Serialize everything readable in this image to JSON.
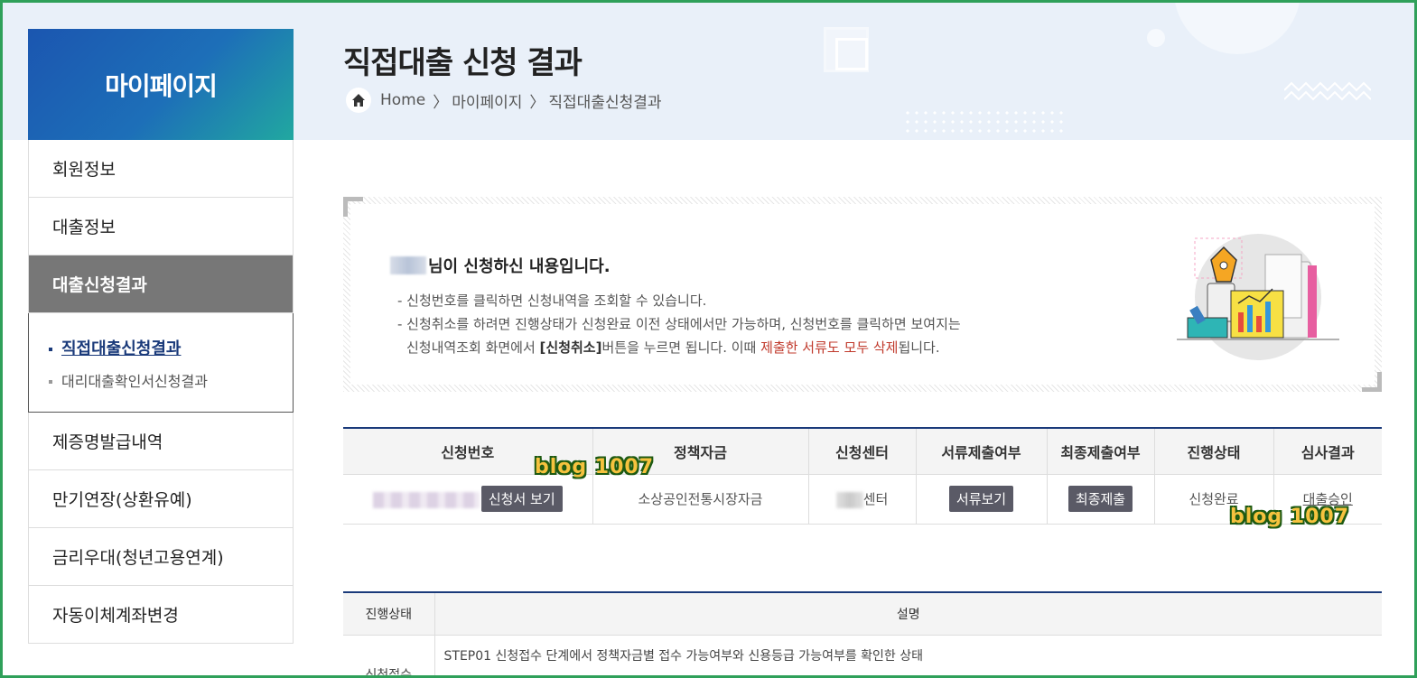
{
  "sidebar": {
    "title": "마이페이지",
    "items": [
      {
        "label": "회원정보"
      },
      {
        "label": "대출정보"
      },
      {
        "label": "대출신청결과"
      }
    ],
    "sub_items": [
      {
        "label": "직접대출신청결과"
      },
      {
        "label": "대리대출확인서신청결과"
      }
    ],
    "items_after": [
      {
        "label": "제증명발급내역"
      },
      {
        "label": "만기연장(상환유예)"
      },
      {
        "label": "금리우대(청년고용연계)"
      },
      {
        "label": "자동이체계좌변경"
      }
    ]
  },
  "header": {
    "title": "직접대출 신청 결과",
    "breadcrumb": [
      "Home",
      "마이페이지",
      "직접대출신청결과"
    ]
  },
  "notice": {
    "heading_suffix": "님이 신청하신 내용입니다.",
    "line1": "- 신청번호를 클릭하면 신청내역을 조회할 수 있습니다.",
    "line2": "- 신청취소를 하려면 진행상태가 신청완료 이전 상태에서만 가능하며, 신청번호를 클릭하면 보여지는",
    "line3_a": "신청내역조회 화면에서 ",
    "line3_b": "[신청취소]",
    "line3_c": "버튼을 누르면 됩니다. 이때 ",
    "line3_d": "제출한 서류도 모두 삭제",
    "line3_e": "됩니다."
  },
  "result_table": {
    "headers": [
      "신청번호",
      "정책자금",
      "신청센터",
      "서류제출여부",
      "최종제출여부",
      "진행상태",
      "심사결과"
    ],
    "row": {
      "apply_button": "신청서 보기",
      "fund": "소상공인전통시장자금",
      "center_suffix": "센터",
      "docs_button": "서류보기",
      "final_button": "최종제출",
      "status": "신청완료",
      "result": "대출승인"
    }
  },
  "desc_table": {
    "headers": [
      "진행상태",
      "설명"
    ],
    "row": {
      "status": "신청접수",
      "desc": "STEP01 신청접수 단계에서 정책자금별 접수 가능여부와 신용등급 가능여부를 확인한 상태"
    }
  },
  "watermarks": [
    "blog 1007",
    "blog 1007"
  ],
  "colors": {
    "accent": "#1a3a7a",
    "frame": "#2fa05a",
    "active_menu": "#777777",
    "warning_text": "#c0392b"
  }
}
